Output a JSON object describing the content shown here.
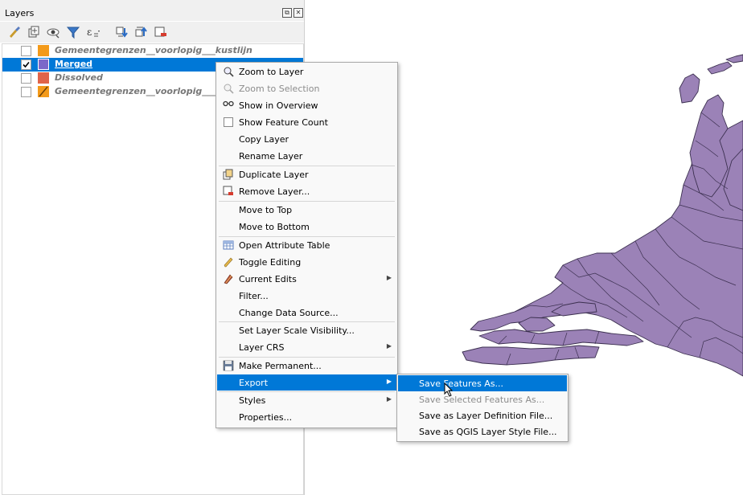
{
  "layers_panel": {
    "title": "Layers",
    "header_buttons": [
      "float-icon",
      "close-icon"
    ],
    "toolbar_icons": [
      "style-manager-icon",
      "add-group-icon",
      "visibility-eye-icon",
      "filter-legend-icon",
      "filter-expression-icon",
      "expand-all-icon",
      "collapse-all-icon",
      "remove-layer-icon"
    ],
    "layers": [
      {
        "label": "Gemeentegrenzen__voorlopig___kustlijn",
        "checked": false,
        "color": "#f39a1a",
        "selected": false
      },
      {
        "label": "Merged",
        "checked": true,
        "color": "#7b68c9",
        "selected": true
      },
      {
        "label": "Dissolved",
        "checked": false,
        "color": "#e0644a",
        "selected": false
      },
      {
        "label": "Gemeentegrenzen__voorlopig___kust",
        "checked": false,
        "color": "#f39a1a",
        "selected": false
      }
    ]
  },
  "context_menu": {
    "items": [
      {
        "label": "Zoom to Layer",
        "icon": "zoom-layer-icon"
      },
      {
        "label": "Zoom to Selection",
        "icon": "zoom-selection-icon",
        "disabled": true
      },
      {
        "label": "Show in Overview",
        "icon": "overview-icon"
      },
      {
        "label": "Show Feature Count",
        "icon": "checkbox-icon"
      },
      {
        "label": "Copy Layer"
      },
      {
        "label": "Rename Layer"
      },
      {
        "label": "Duplicate Layer",
        "icon": "duplicate-icon"
      },
      {
        "label": "Remove Layer...",
        "icon": "remove-layer-icon"
      },
      {
        "label": "Move to Top"
      },
      {
        "label": "Move to Bottom"
      },
      {
        "label": "Open Attribute Table",
        "icon": "attribute-table-icon"
      },
      {
        "label": "Toggle Editing",
        "icon": "pencil-icon"
      },
      {
        "label": "Current Edits",
        "icon": "current-edits-icon",
        "submenu": true
      },
      {
        "label": "Filter..."
      },
      {
        "label": "Change Data Source..."
      },
      {
        "label": "Set Layer Scale Visibility..."
      },
      {
        "label": "Layer CRS",
        "submenu": true
      },
      {
        "label": "Make Permanent...",
        "icon": "save-icon"
      },
      {
        "label": "Export",
        "submenu": true,
        "highlighted": true
      },
      {
        "label": "Styles",
        "submenu": true
      },
      {
        "label": "Properties..."
      }
    ]
  },
  "export_submenu": {
    "items": [
      {
        "label": "Save Features As...",
        "highlighted": true
      },
      {
        "label": "Save Selected Features As...",
        "disabled": true
      },
      {
        "label": "Save as Layer Definition File..."
      },
      {
        "label": "Save as QGIS Layer Style File..."
      }
    ]
  },
  "map": {
    "fill_color": "#9b82b7",
    "stroke_color": "#3c3050"
  },
  "colors": {
    "accent": "#0078d7"
  }
}
